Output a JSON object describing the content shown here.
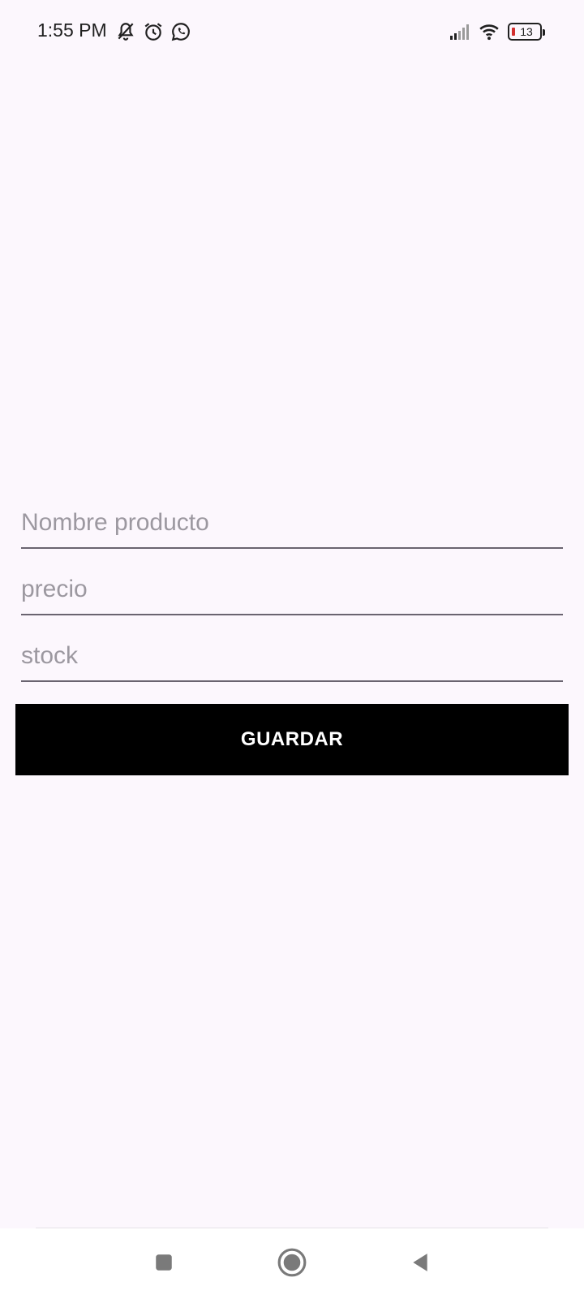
{
  "status_bar": {
    "time": "1:55 PM",
    "battery_level": "13",
    "icons_left": [
      "bell-off-icon",
      "alarm-icon",
      "whatsapp-icon"
    ],
    "icons_right": [
      "signal-icon",
      "wifi-icon",
      "battery-icon"
    ]
  },
  "form": {
    "name_placeholder": "Nombre producto",
    "name_value": "",
    "price_placeholder": "precio",
    "price_value": "",
    "stock_placeholder": "stock",
    "stock_value": "",
    "save_label": "GUARDAR"
  },
  "nav_bar": {
    "buttons": [
      "recent-apps-icon",
      "home-icon",
      "back-icon"
    ]
  },
  "colors": {
    "background": "#fcf7fd",
    "button": "#000000",
    "button_text": "#ffffff",
    "underline": "#6a6470",
    "placeholder": "#9c98a0",
    "battery_low": "#d32f2f"
  }
}
